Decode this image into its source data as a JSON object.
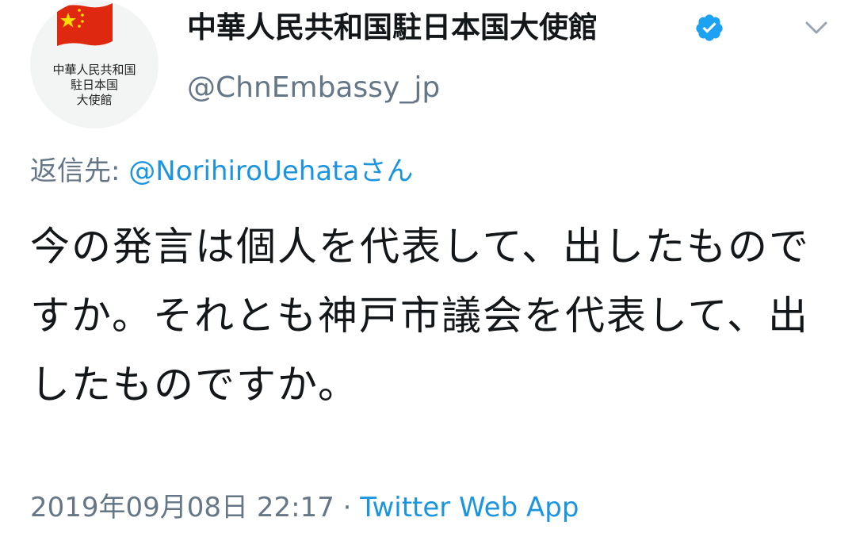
{
  "account": {
    "avatar_text": [
      "中華人民共和国",
      "駐日本国",
      "大使館"
    ],
    "display_name": "中華人民共和国駐日本国大使館",
    "screen_name": "@ChnEmbassy_jp",
    "verified_icon": "verified-badge-icon",
    "menu_icon": "chevron-down-icon"
  },
  "reply": {
    "label": "返信先:",
    "user": "@NorihiroUehataさん"
  },
  "tweet": {
    "text": "今の発言は個人を代表して、出したものですか。それとも神戸市議会を代表して、出したものですか。"
  },
  "meta": {
    "timestamp": "2019年09月08日 22:17",
    "separator": "·",
    "source": "Twitter Web App"
  },
  "colors": {
    "accent": "#1b95e0",
    "secondary_text": "#657786",
    "flag_red": "#de2910",
    "flag_yellow": "#ffde00"
  }
}
